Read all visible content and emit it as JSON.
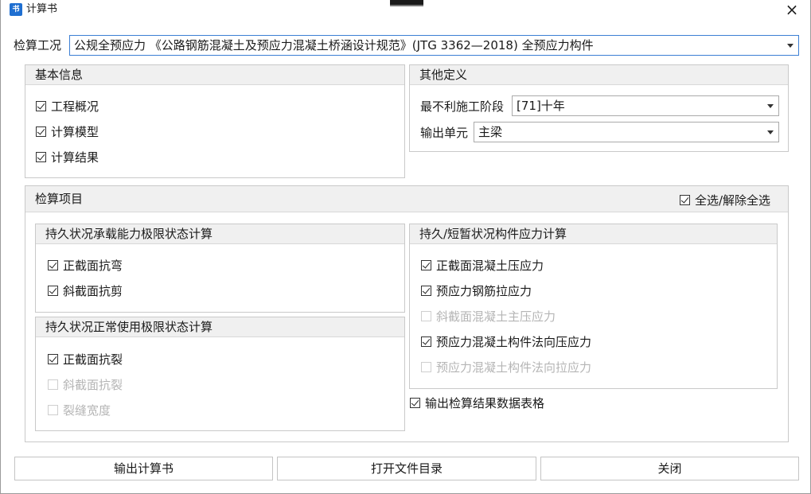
{
  "window": {
    "title": "计算书",
    "close_glyph": "×",
    "app_icon_text": "书"
  },
  "case": {
    "label": "检算工况",
    "value": "公规全预应力 《公路钢筋混凝土及预应力混凝土桥涵设计规范》(JTG 3362—2018) 全预应力构件"
  },
  "basic_info": {
    "title": "基本信息",
    "items": [
      {
        "label": "工程概况",
        "checked": true,
        "enabled": true
      },
      {
        "label": "计算模型",
        "checked": true,
        "enabled": true
      },
      {
        "label": "计算结果",
        "checked": true,
        "enabled": true
      }
    ]
  },
  "other_def": {
    "title": "其他定义",
    "stage_label": "最不利施工阶段",
    "stage_value": "[71]十年",
    "unit_label": "输出单元",
    "unit_value": "主梁"
  },
  "check_items": {
    "title": "检算项目",
    "select_all": {
      "label": "全选/解除全选",
      "checked": true
    },
    "ultimate": {
      "title": "持久状况承载能力极限状态计算",
      "items": [
        {
          "label": "正截面抗弯",
          "checked": true,
          "enabled": true
        },
        {
          "label": "斜截面抗剪",
          "checked": true,
          "enabled": true
        }
      ]
    },
    "serviceability": {
      "title": "持久状况正常使用极限状态计算",
      "items": [
        {
          "label": "正截面抗裂",
          "checked": true,
          "enabled": true
        },
        {
          "label": "斜截面抗裂",
          "checked": false,
          "enabled": false
        },
        {
          "label": "裂缝宽度",
          "checked": false,
          "enabled": false
        }
      ]
    },
    "stress": {
      "title": "持久/短暂状况构件应力计算",
      "items": [
        {
          "label": "正截面混凝土压应力",
          "checked": true,
          "enabled": true
        },
        {
          "label": "预应力钢筋拉应力",
          "checked": true,
          "enabled": true
        },
        {
          "label": "斜截面混凝土主压应力",
          "checked": false,
          "enabled": false
        },
        {
          "label": "预应力混凝土构件法向压应力",
          "checked": true,
          "enabled": true
        },
        {
          "label": "预应力混凝土构件法向拉应力",
          "checked": false,
          "enabled": false
        }
      ]
    },
    "output_table": {
      "label": "输出检算结果数据表格",
      "checked": true
    }
  },
  "buttons": {
    "output": "输出计算书",
    "open_dir": "打开文件目录",
    "close": "关闭"
  }
}
